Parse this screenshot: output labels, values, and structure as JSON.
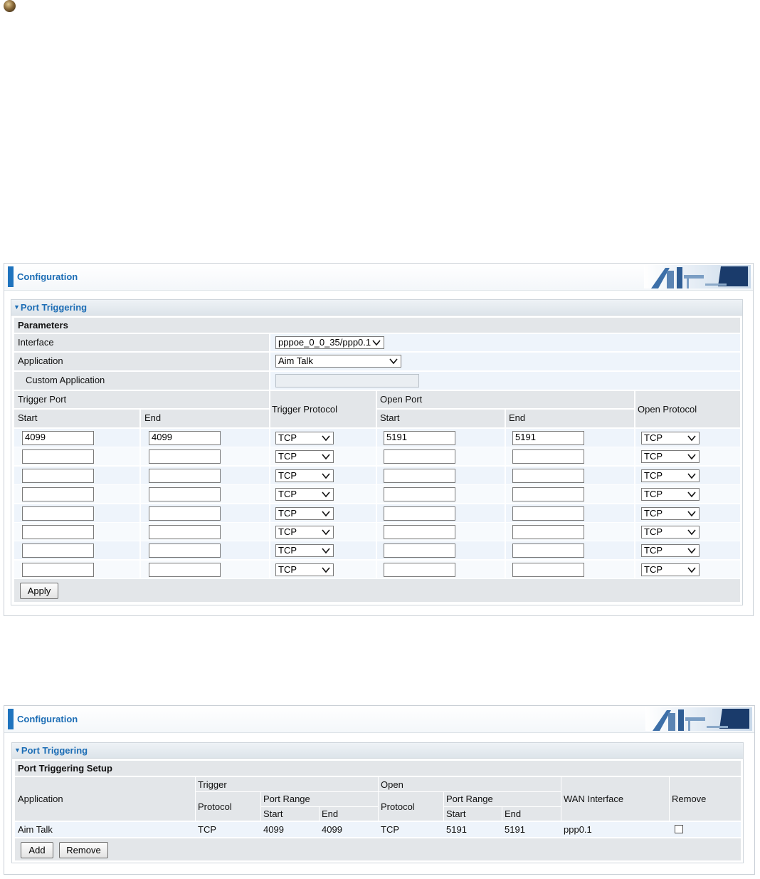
{
  "panel1": {
    "config_title": "Configuration",
    "section_title": "Port Triggering",
    "parameters_label": "Parameters",
    "interface_label": "Interface",
    "interface_value": "pppoe_0_0_35/ppp0.1",
    "application_label": "Application",
    "application_value": "Aim Talk",
    "custom_application_label": "Custom Application",
    "custom_application_value": "",
    "headers": {
      "trigger_port": "Trigger Port",
      "start": "Start",
      "end": "End",
      "trigger_protocol": "Trigger Protocol",
      "open_port": "Open Port",
      "open_start": "Start",
      "open_end": "End",
      "open_protocol": "Open Protocol"
    },
    "rows": [
      {
        "trigger_start": "4099",
        "trigger_end": "4099",
        "trigger_protocol": "TCP",
        "open_start": "5191",
        "open_end": "5191",
        "open_protocol": "TCP"
      },
      {
        "trigger_start": "",
        "trigger_end": "",
        "trigger_protocol": "TCP",
        "open_start": "",
        "open_end": "",
        "open_protocol": "TCP"
      },
      {
        "trigger_start": "",
        "trigger_end": "",
        "trigger_protocol": "TCP",
        "open_start": "",
        "open_end": "",
        "open_protocol": "TCP"
      },
      {
        "trigger_start": "",
        "trigger_end": "",
        "trigger_protocol": "TCP",
        "open_start": "",
        "open_end": "",
        "open_protocol": "TCP"
      },
      {
        "trigger_start": "",
        "trigger_end": "",
        "trigger_protocol": "TCP",
        "open_start": "",
        "open_end": "",
        "open_protocol": "TCP"
      },
      {
        "trigger_start": "",
        "trigger_end": "",
        "trigger_protocol": "TCP",
        "open_start": "",
        "open_end": "",
        "open_protocol": "TCP"
      },
      {
        "trigger_start": "",
        "trigger_end": "",
        "trigger_protocol": "TCP",
        "open_start": "",
        "open_end": "",
        "open_protocol": "TCP"
      },
      {
        "trigger_start": "",
        "trigger_end": "",
        "trigger_protocol": "TCP",
        "open_start": "",
        "open_end": "",
        "open_protocol": "TCP"
      }
    ],
    "apply_label": "Apply"
  },
  "panel2": {
    "config_title": "Configuration",
    "section_title": "Port Triggering",
    "setup_label": "Port Triggering Setup",
    "headers": {
      "application": "Application",
      "trigger": "Trigger",
      "trigger_protocol": "Protocol",
      "trigger_port_range": "Port Range",
      "trigger_start": "Start",
      "trigger_end": "End",
      "open": "Open",
      "open_protocol": "Protocol",
      "open_port_range": "Port Range",
      "open_start": "Start",
      "open_end": "End",
      "wan_interface": "WAN Interface",
      "remove": "Remove"
    },
    "entries": [
      {
        "application": "Aim Talk",
        "trigger_protocol": "TCP",
        "trigger_start": "4099",
        "trigger_end": "4099",
        "open_protocol": "TCP",
        "open_start": "5191",
        "open_end": "5191",
        "wan_interface": "ppp0.1",
        "remove": false
      }
    ],
    "add_label": "Add",
    "remove_label": "Remove"
  }
}
